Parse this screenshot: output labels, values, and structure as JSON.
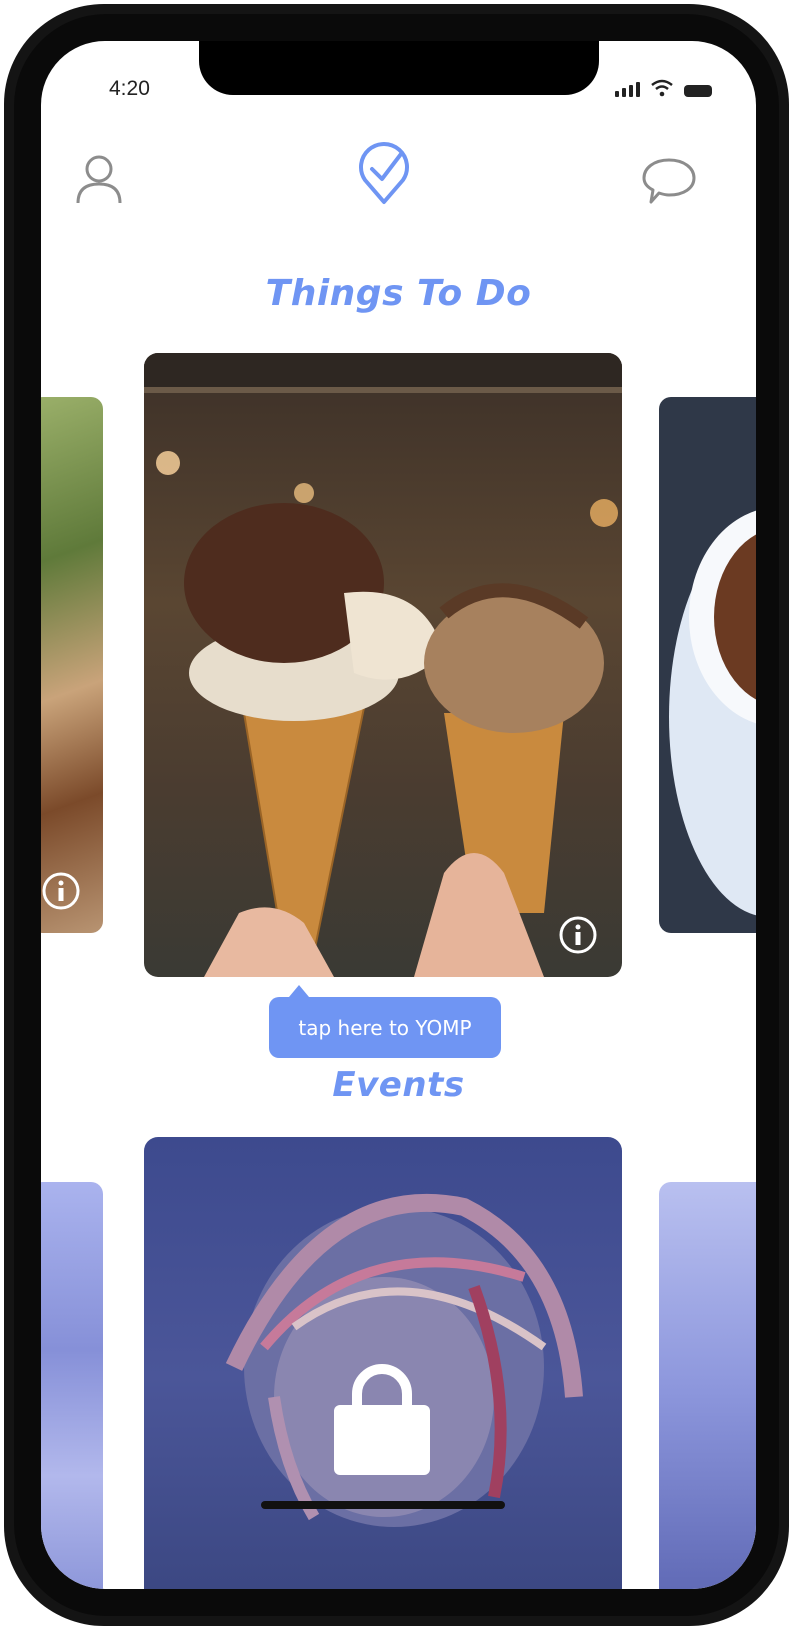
{
  "status_bar": {
    "time": "4:20"
  },
  "header": {
    "left_icon": "profile-icon",
    "center_icon": "yomp-logo-icon",
    "right_icon": "chat-bubble-icon"
  },
  "sections": {
    "things_to_do": {
      "title": "Things To Do",
      "cards": [
        {
          "name": "plant-person-photo"
        },
        {
          "name": "ice-cream-cones-photo"
        },
        {
          "name": "coffee-cup-photo"
        }
      ]
    },
    "events": {
      "title": "Events",
      "cards": [
        {
          "name": "blurred-lights-photo"
        },
        {
          "name": "dreadlocks-performer-photo"
        },
        {
          "name": "stage-lights-photo"
        }
      ]
    }
  },
  "tooltip": {
    "text": "tap here to YOMP"
  },
  "colors": {
    "accent": "#6f95f3",
    "overlay": "#4a5aa8"
  }
}
